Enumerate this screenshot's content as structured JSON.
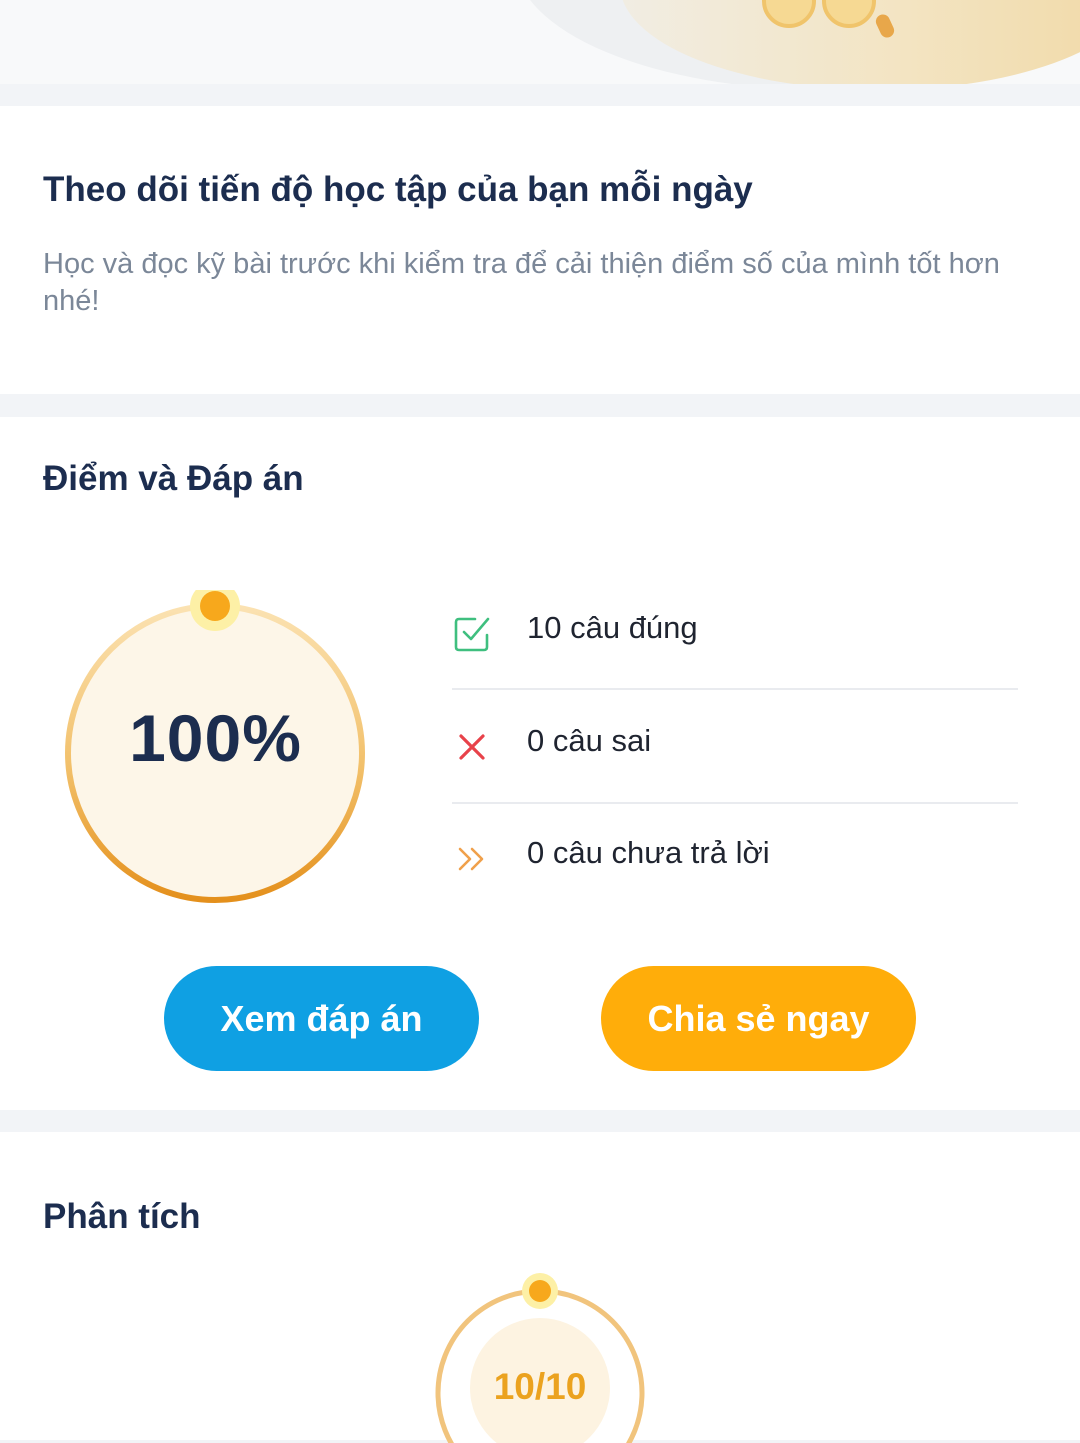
{
  "intro": {
    "title": "Theo dõi tiến độ học tập của bạn mỗi ngày",
    "description": "Học và đọc kỹ bài trước khi kiểm tra để cải thiện điểm số của mình tốt hơn nhé!"
  },
  "score_section": {
    "title": "Điểm và Đáp án",
    "percent_label": "100%",
    "percent_value": 100,
    "stats": {
      "correct": {
        "label": "10 câu đúng",
        "icon": "check-square-icon",
        "color": "#3fbf7f"
      },
      "wrong": {
        "label": "0 câu sai",
        "icon": "close-x-icon",
        "color": "#e8424a"
      },
      "skipped": {
        "label": "0 câu chưa trả lời",
        "icon": "double-chevron-right-icon",
        "color": "#f0a04b"
      }
    },
    "buttons": {
      "view_answers": "Xem đáp án",
      "share": "Chia sẻ ngay"
    }
  },
  "analysis": {
    "title": "Phân tích",
    "score_label": "10/10"
  },
  "colors": {
    "accent_blue": "#0fa0e3",
    "accent_orange": "#ffad0a",
    "ring_gold": "#eba21f",
    "title_navy": "#1c2d4f"
  }
}
